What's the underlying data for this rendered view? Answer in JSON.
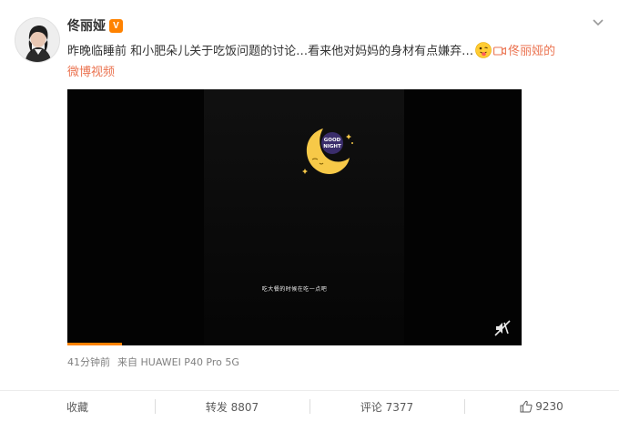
{
  "post": {
    "username": "佟丽娅",
    "verified_badge": "V",
    "text_main": "昨晚临睡前 和小肥朵儿关于吃饭问题的讨论…看来他对妈妈的身材有点嫌弃…",
    "video_link_name": "佟丽娅",
    "video_link_suffix": "的",
    "video_link_line2": "微博视频",
    "emoji_name": "tongue-out-emoji",
    "video_icon": "video-camera-icon"
  },
  "video": {
    "moon_text_line1": "GOOD",
    "moon_text_line2": "NIGHT",
    "subtitle": "吃大餐的时候在吃一点吧",
    "progress_fraction": 0.12,
    "mute_icon": "muted-speaker-icon"
  },
  "meta": {
    "time": "41分钟前",
    "source": "来自 HUAWEI P40 Pro 5G"
  },
  "toolbar": {
    "favorite": "收藏",
    "repost": "转发 8807",
    "comment": "评论 7377",
    "like": "9230",
    "like_icon": "thumbs-up-icon"
  },
  "colors": {
    "accent": "#ff8200",
    "link": "#eb7350",
    "text": "#333333",
    "meta_text": "#808080"
  }
}
